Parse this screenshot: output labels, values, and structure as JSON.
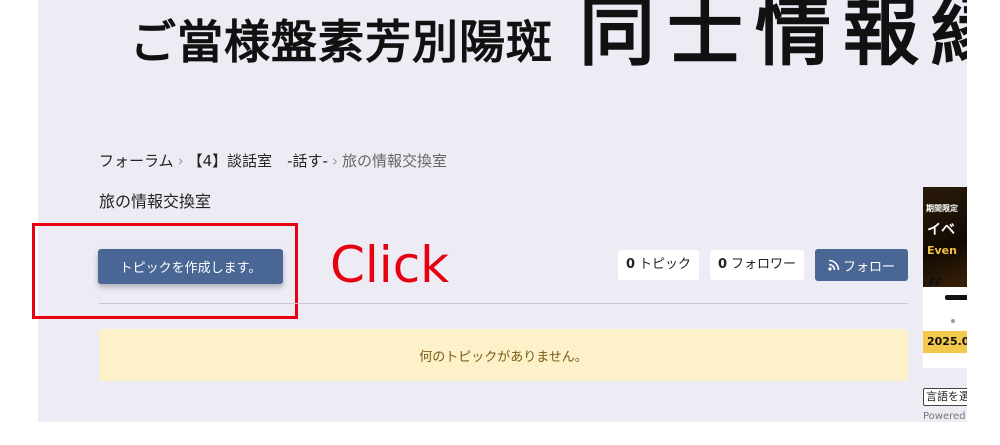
{
  "header": {
    "banner_small": "ご當様盤素芳別陽斑",
    "banner_large": "同士情報縁"
  },
  "breadcrumb": {
    "items": [
      {
        "label": "フォーラム"
      },
      {
        "label": "【4】談話室　-話す-"
      },
      {
        "label": "旅の情報交換室"
      }
    ],
    "separator": "›"
  },
  "page": {
    "title": "旅の情報交換室"
  },
  "actions": {
    "create_topic_label": "トピックを作成します。"
  },
  "annotation": {
    "label": "Click",
    "color": "#e60012"
  },
  "stats": {
    "topics_count": "0",
    "topics_label": "トピック",
    "followers_count": "0",
    "followers_label": "フォロワー",
    "follow_label": "フォロー",
    "follow_icon": "rss-icon"
  },
  "notice": {
    "text": "何のトピックがありません。"
  },
  "sidebar_ad": {
    "tag": "期間限定",
    "jp": "イベ",
    "en": "Even",
    "quote": "“",
    "date": "2025.0"
  },
  "footer_widgets": {
    "language_select": "言語を選択",
    "powered": "Powered by"
  },
  "colors": {
    "primary": "#4a6694",
    "panel_bg": "#edecf5",
    "notice_bg": "#fdf1c9",
    "notice_text": "#7a5a16",
    "annotation": "#e60012"
  }
}
